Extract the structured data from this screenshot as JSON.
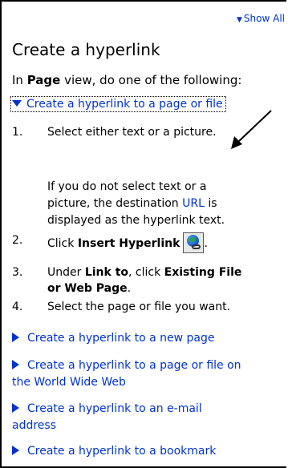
{
  "show_all": "Show All",
  "title": "Create a hyperlink",
  "intro": {
    "prefix": "In ",
    "bold": "Page",
    "suffix": " view, do one of the following:"
  },
  "expanded_link": "Create a hyperlink to a page or file",
  "steps": [
    {
      "num": "1.",
      "text": "Select either text or a picture."
    },
    {
      "num": "2.",
      "pre": "Click ",
      "bold": "Insert Hyperlink",
      "post": "."
    },
    {
      "num": "3.",
      "pre": "Under ",
      "bold1": "Link to",
      "mid": ", click ",
      "bold2": "Existing File",
      "bold2b": "or Web Page",
      "post": "."
    },
    {
      "num": "4.",
      "text": "Select the page or file you want."
    }
  ],
  "note": {
    "line1": "If you do not select text or a",
    "line2_pre": "picture, the destination ",
    "line2_link": "URL",
    "line2_post": " is",
    "line3": "displayed as the hyperlink text."
  },
  "sub_links": [
    {
      "line1": "Create a hyperlink to a new page"
    },
    {
      "line1": "Create a hyperlink to a page or file on",
      "line2": "the World Wide Web"
    },
    {
      "line1": "Create a hyperlink to an e-mail",
      "line2": "address"
    },
    {
      "line1": "Create a hyperlink to a bookmark"
    }
  ],
  "icons": {
    "insert_hyperlink": "globe-chain-icon",
    "expand": "triangle-down-icon",
    "collapsed": "triangle-right-icon"
  }
}
